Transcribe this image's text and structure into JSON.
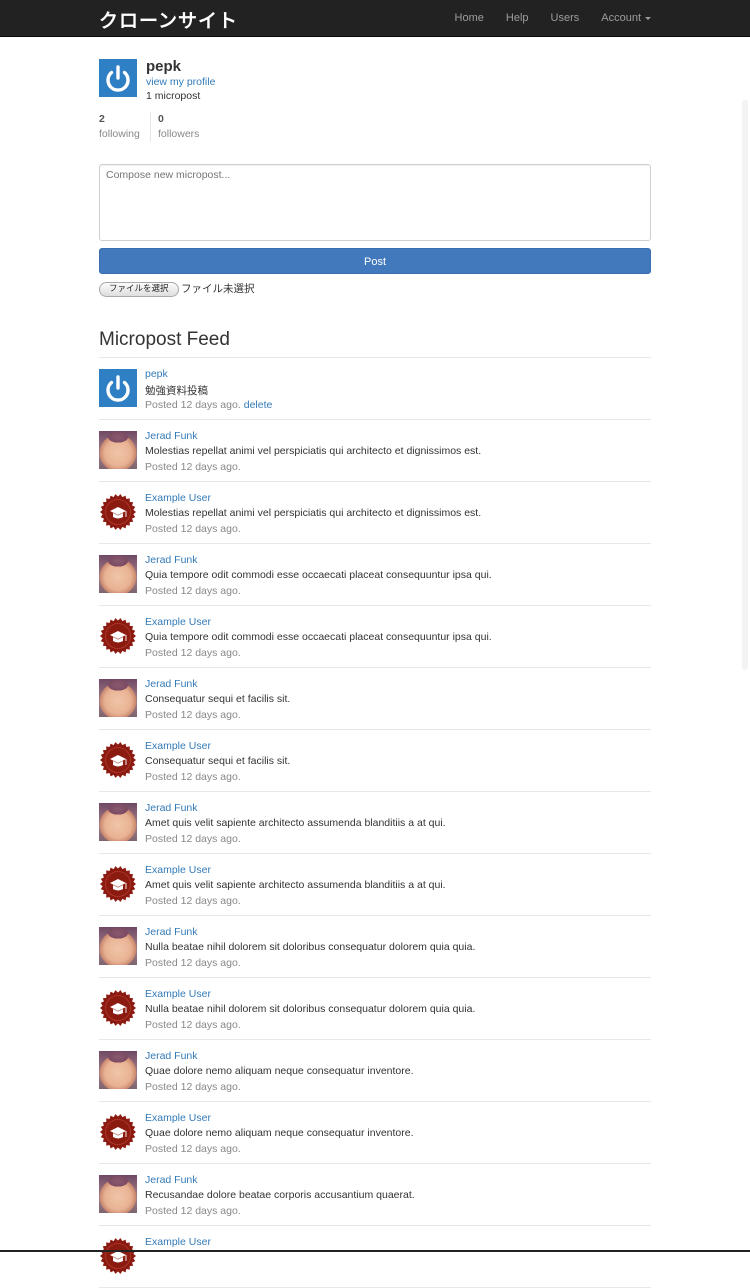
{
  "navbar": {
    "brand": "クローンサイト",
    "links": {
      "home": "Home",
      "help": "Help",
      "users": "Users",
      "account": "Account"
    }
  },
  "profile": {
    "name": "pepk",
    "view_profile": "view my profile",
    "micropost_count": "1 micropost",
    "following_count": "2",
    "following_label": "following",
    "followers_count": "0",
    "followers_label": "followers"
  },
  "compose": {
    "placeholder": "Compose new micropost...",
    "post_label": "Post",
    "file_button": "ファイルを選択",
    "file_status": "ファイル未選択"
  },
  "feed": {
    "title": "Micropost Feed",
    "items": [
      {
        "user": "pepk",
        "avatar": "power-icon",
        "content": "勉強資料投稿",
        "timestamp": "Posted 12 days ago.",
        "delete": "delete"
      },
      {
        "user": "Jerad Funk",
        "avatar": "baby-photo",
        "content": "Molestias repellat animi vel perspiciatis qui architecto et dignissimos est.",
        "timestamp": "Posted 12 days ago."
      },
      {
        "user": "Example User",
        "avatar": "graduation-cap-icon",
        "content": "Molestias repellat animi vel perspiciatis qui architecto et dignissimos est.",
        "timestamp": "Posted 12 days ago."
      },
      {
        "user": "Jerad Funk",
        "avatar": "baby-photo",
        "content": "Quia tempore odit commodi esse occaecati placeat consequuntur ipsa qui.",
        "timestamp": "Posted 12 days ago."
      },
      {
        "user": "Example User",
        "avatar": "graduation-cap-icon",
        "content": "Quia tempore odit commodi esse occaecati placeat consequuntur ipsa qui.",
        "timestamp": "Posted 12 days ago."
      },
      {
        "user": "Jerad Funk",
        "avatar": "baby-photo",
        "content": "Consequatur sequi et facilis sit.",
        "timestamp": "Posted 12 days ago."
      },
      {
        "user": "Example User",
        "avatar": "graduation-cap-icon",
        "content": "Consequatur sequi et facilis sit.",
        "timestamp": "Posted 12 days ago."
      },
      {
        "user": "Jerad Funk",
        "avatar": "baby-photo",
        "content": "Amet quis velit sapiente architecto assumenda blanditiis a at qui.",
        "timestamp": "Posted 12 days ago."
      },
      {
        "user": "Example User",
        "avatar": "graduation-cap-icon",
        "content": "Amet quis velit sapiente architecto assumenda blanditiis a at qui.",
        "timestamp": "Posted 12 days ago."
      },
      {
        "user": "Jerad Funk",
        "avatar": "baby-photo",
        "content": "Nulla beatae nihil dolorem sit doloribus consequatur dolorem quia quia.",
        "timestamp": "Posted 12 days ago."
      },
      {
        "user": "Example User",
        "avatar": "graduation-cap-icon",
        "content": "Nulla beatae nihil dolorem sit doloribus consequatur dolorem quia quia.",
        "timestamp": "Posted 12 days ago."
      },
      {
        "user": "Jerad Funk",
        "avatar": "baby-photo",
        "content": "Quae dolore nemo aliquam neque consequatur inventore.",
        "timestamp": "Posted 12 days ago."
      },
      {
        "user": "Example User",
        "avatar": "graduation-cap-icon",
        "content": "Quae dolore nemo aliquam neque consequatur inventore.",
        "timestamp": "Posted 12 days ago."
      },
      {
        "user": "Jerad Funk",
        "avatar": "baby-photo",
        "content": "Recusandae dolore beatae corporis accusantium quaerat.",
        "timestamp": "Posted 12 days ago."
      },
      {
        "user": "Example User",
        "avatar": "graduation-cap-icon",
        "content": "",
        "timestamp": ""
      }
    ]
  },
  "colors": {
    "navbar_bg": "#222222",
    "link": "#337ab7",
    "primary_button": "#4179bc",
    "avatar_blue": "#2f7fc4",
    "avatar_red": "#8b1a10"
  }
}
